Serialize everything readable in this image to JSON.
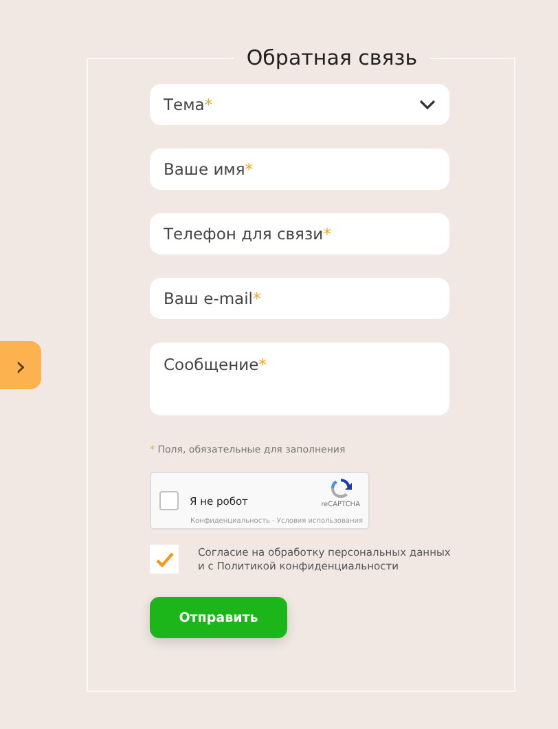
{
  "side_tab": {
    "icon": "›"
  },
  "form": {
    "title": "Обратная связь",
    "fields": [
      {
        "kind": "select",
        "placeholder": "Тема",
        "required_mark": "*"
      },
      {
        "kind": "text",
        "placeholder": "Ваше имя",
        "required_mark": "*"
      },
      {
        "kind": "text",
        "placeholder": "Телефон для связи",
        "required_mark": "*"
      },
      {
        "kind": "text",
        "placeholder": "Ваш e-mail",
        "required_mark": "*"
      },
      {
        "kind": "textarea",
        "placeholder": "Сообщение",
        "required_mark": "*"
      }
    ],
    "required_note": {
      "mark": "*",
      "text": "Поля, обязательные для заполнения"
    },
    "captcha": {
      "checked": false,
      "label": "Я не робот",
      "brand": "reCAPTCHA",
      "links": "Конфиденциальность - Условия использования"
    },
    "consent": {
      "checked": true,
      "label": "Согласие на обработку персональных данных и с Политикой конфиденциальности"
    },
    "submit": "Отправить"
  }
}
